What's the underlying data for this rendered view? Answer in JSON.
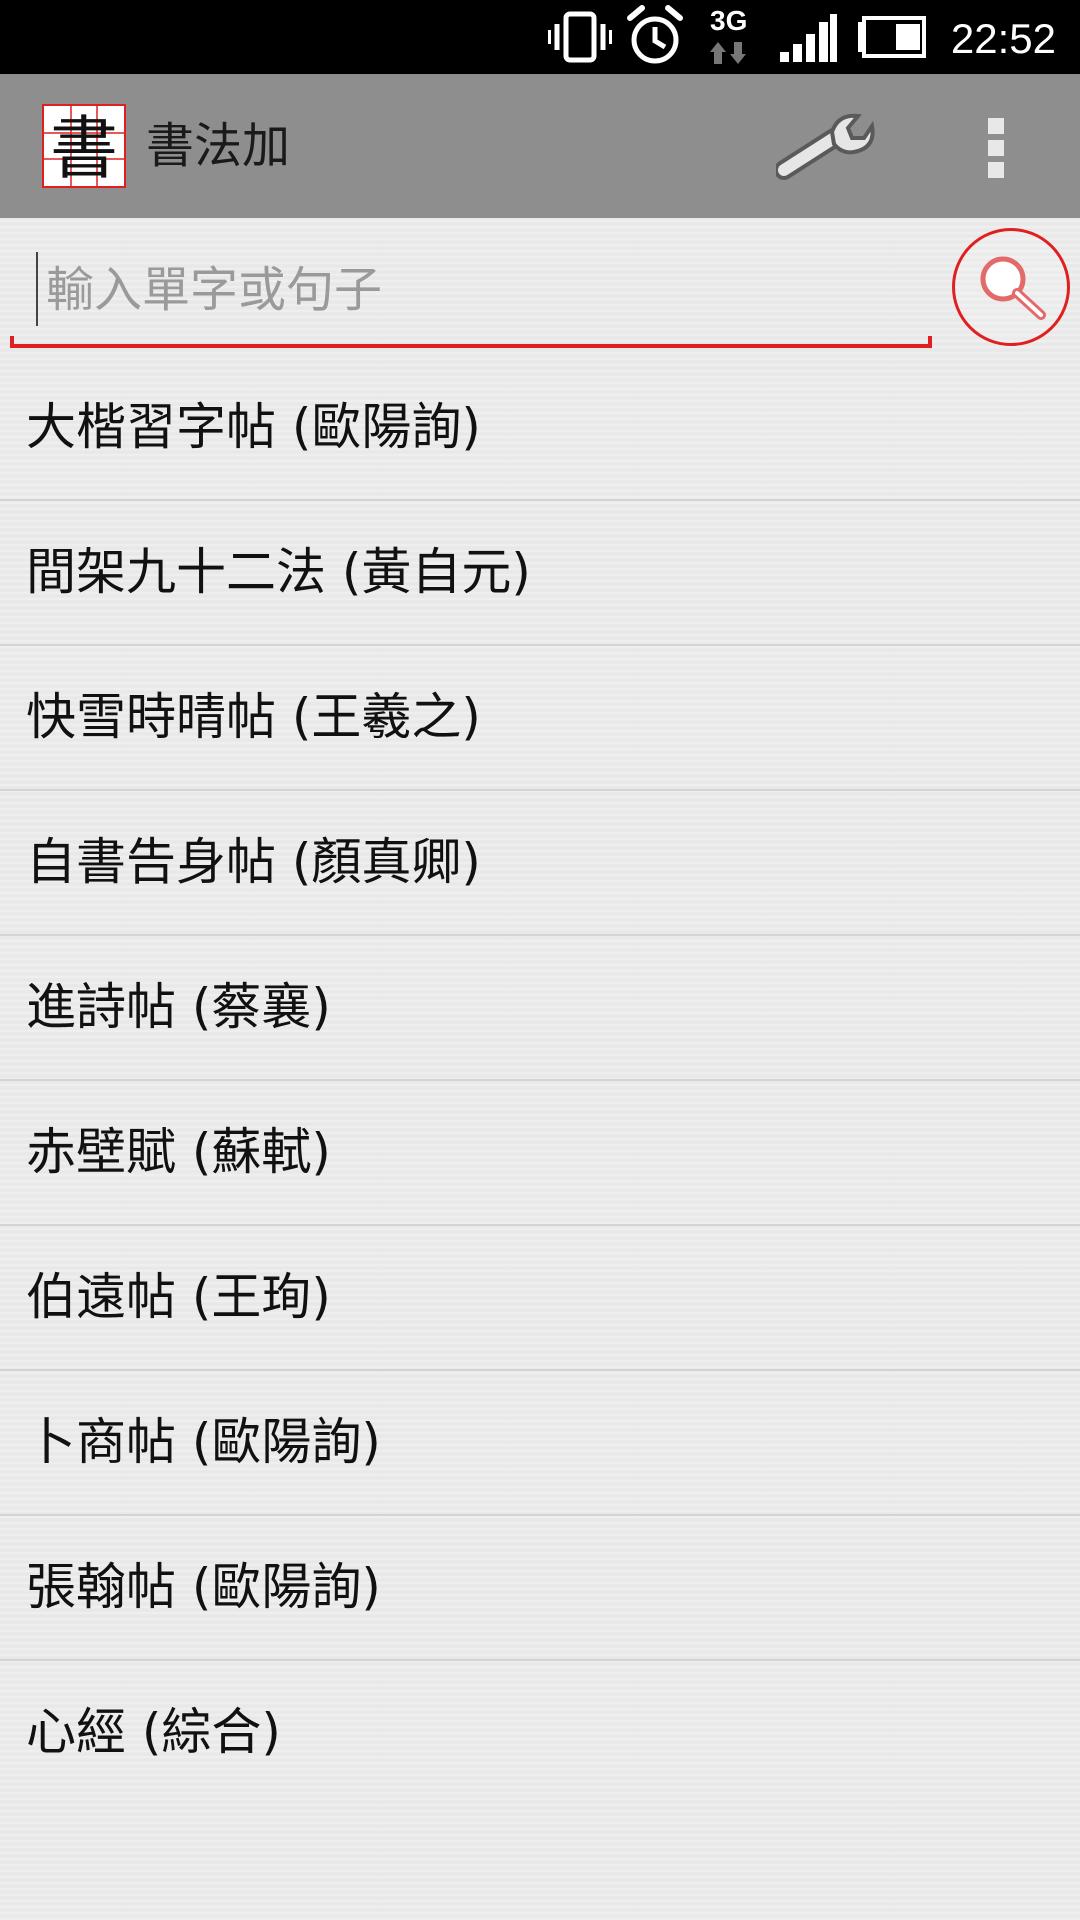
{
  "status_bar": {
    "time": "22:52",
    "network_type": "3G",
    "icons": [
      "vibrate-icon",
      "alarm-icon",
      "network-3g-icon",
      "signal-icon",
      "battery-icon"
    ]
  },
  "action_bar": {
    "title": "書法加",
    "logo_char": "書",
    "settings_icon": "wrench-icon",
    "overflow_icon": "overflow-menu-icon"
  },
  "search": {
    "placeholder": "輸入單字或句子",
    "value": "",
    "button_icon": "search-icon"
  },
  "colors": {
    "accent": "#e02020",
    "action_bar": "#8e8e8e",
    "background": "#ebebeb"
  },
  "list": {
    "items": [
      {
        "label": "大楷習字帖 (歐陽詢)"
      },
      {
        "label": "間架九十二法 (黃自元)"
      },
      {
        "label": "快雪時晴帖 (王羲之)"
      },
      {
        "label": "自書告身帖 (顏真卿)"
      },
      {
        "label": "進詩帖 (蔡襄)"
      },
      {
        "label": "赤壁賦 (蘇軾)"
      },
      {
        "label": "伯遠帖 (王珣)"
      },
      {
        "label": "卜商帖 (歐陽詢)"
      },
      {
        "label": "張翰帖 (歐陽詢)"
      },
      {
        "label": "心經 (綜合)"
      }
    ]
  }
}
